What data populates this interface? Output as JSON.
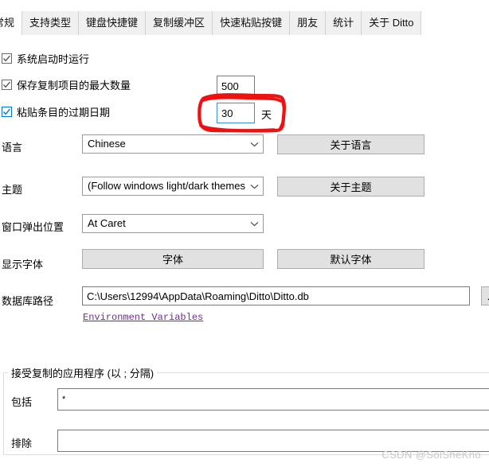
{
  "window": {
    "app": "Ditto"
  },
  "tabs": [
    {
      "label": "常规",
      "active": true
    },
    {
      "label": "支持类型",
      "active": false
    },
    {
      "label": "键盘快捷键",
      "active": false
    },
    {
      "label": "复制缓冲区",
      "active": false
    },
    {
      "label": "快速粘贴按键",
      "active": false
    },
    {
      "label": "朋友",
      "active": false
    },
    {
      "label": "统计",
      "active": false
    },
    {
      "label": "关于 Ditto",
      "active": false
    }
  ],
  "checkboxes": [
    {
      "label": "系统启动时运行",
      "checked": true,
      "focused": false
    },
    {
      "label": "保存复制项目的最大数量",
      "checked": true,
      "focused": false
    },
    {
      "label": "粘贴条目的过期日期",
      "checked": true,
      "focused": true
    }
  ],
  "fields": {
    "max_copies_value": "500",
    "expire_days_value": "30",
    "expire_days_unit": "天"
  },
  "rows": {
    "language": {
      "label": "语言",
      "value": "Chinese",
      "button": "关于语言"
    },
    "theme": {
      "label": "主题",
      "value": "(Follow windows light/dark themes)",
      "button": "关于主题"
    },
    "popup_position": {
      "label": "窗口弹出位置",
      "value": "At Caret"
    },
    "display_font": {
      "label": "显示字体",
      "button": "字体",
      "button_default": "默认字体"
    },
    "db_path": {
      "label": "数据库路径",
      "value": "C:\\Users\\12994\\AppData\\Roaming\\Ditto\\Ditto.db",
      "browse_button": "...",
      "env_link": "Environment Variables"
    }
  },
  "group": {
    "title": "接受复制的应用程序 (以 ; 分隔)",
    "include_label": "包括",
    "include_value": "*",
    "exclude_label": "排除",
    "exclude_value": ""
  },
  "annotation": {
    "color": "#ee1111",
    "shape": "hand-drawn-rounded-rectangle"
  },
  "watermark": {
    "text": "CSDN @SolSheKno"
  },
  "colors": {
    "accent": "#0078d7",
    "focus_border": "#3e8ddd",
    "link": "#6f2e8f",
    "annotation_red": "#ee1111",
    "button_face": "#e1e1e1",
    "tabstrip": "#f0f0f0"
  }
}
